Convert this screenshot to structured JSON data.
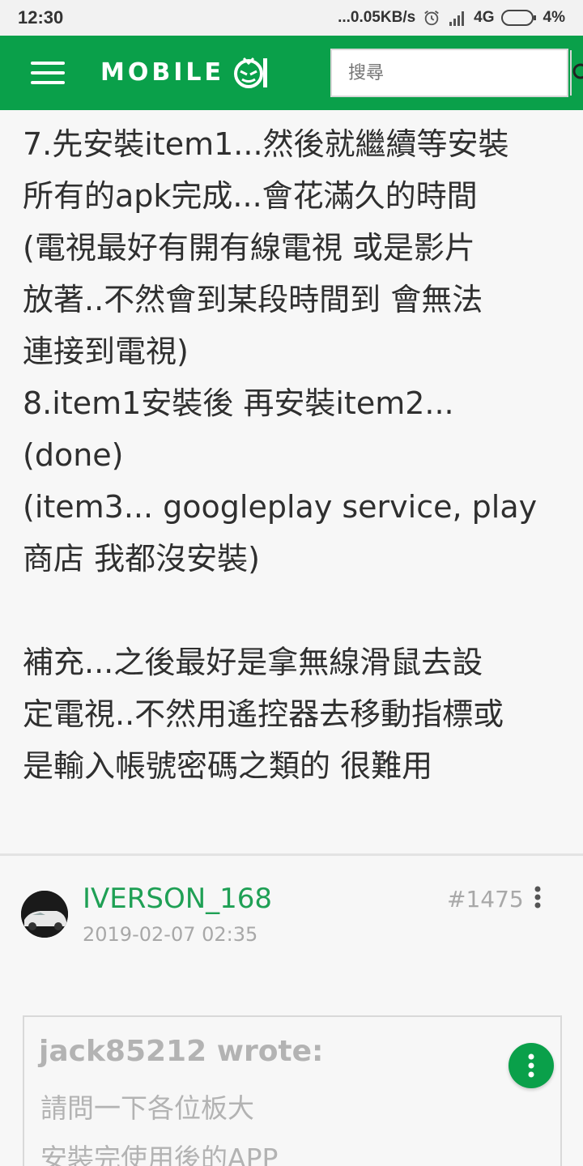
{
  "status_bar": {
    "time": "12:30",
    "network_speed": "...0.05KB/s",
    "network_type": "4G",
    "battery": "4%"
  },
  "app_bar": {
    "logo_text": "MOBILE",
    "search_placeholder": "搜尋",
    "accent_color": "#0aa04a"
  },
  "post": {
    "lines": [
      "7.先安裝item1...然後就繼續等安裝",
      "所有的apk完成...會花滿久的時間",
      "(電視最好有開有線電視 或是影片",
      "放著..不然會到某段時間到 會無法",
      "連接到電視)",
      "8.item1安裝後 再安裝item2...",
      "(done)",
      "(item3... googleplay service, play",
      "商店 我都沒安裝)"
    ],
    "supplement_lines": [
      "補充...之後最好是拿無線滑鼠去設",
      "定電視..不然用遙控器去移動指標或",
      "是輸入帳號密碼之類的 很難用"
    ]
  },
  "reply": {
    "username": "IVERSON_168",
    "timestamp": "2019-02-07 02:35",
    "post_number": "#1475",
    "quote": {
      "author": "jack85212 wrote:",
      "lines": [
        "請問一下各位板大",
        "安裝完使用後的APP"
      ]
    }
  }
}
